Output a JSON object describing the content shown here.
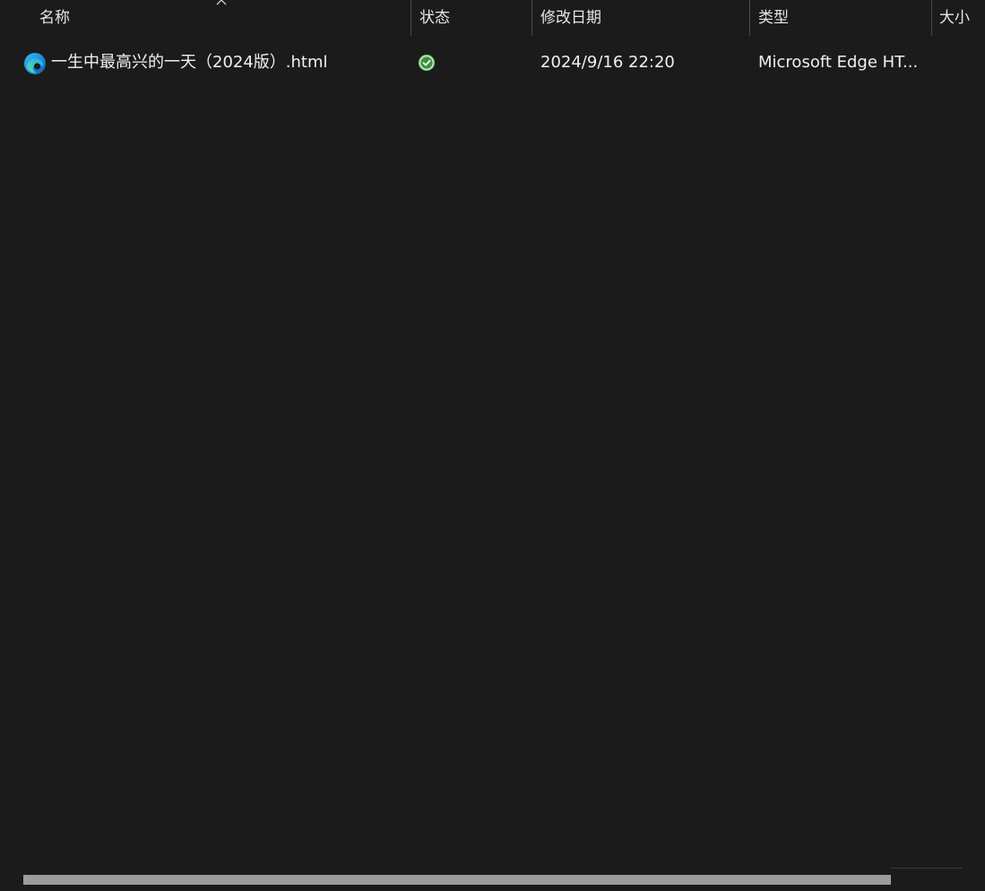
{
  "header": {
    "columns": {
      "name": "名称",
      "status": "状态",
      "modified": "修改日期",
      "type": "类型",
      "size": "大小"
    },
    "sort_indicator": "^"
  },
  "files": [
    {
      "name": "一生中最高兴的一天（2024版）.html",
      "status_icon": "synced-check-icon",
      "modified": "2024/9/16 22:20",
      "type": "Microsoft Edge HT...",
      "size": "",
      "icon": "edge-html-icon"
    }
  ],
  "colors": {
    "background": "#1b1b1b",
    "status_green": "#6cc66c"
  }
}
